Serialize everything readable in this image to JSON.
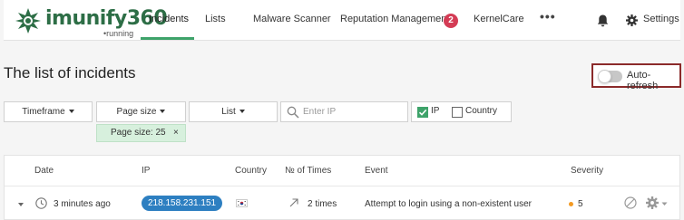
{
  "brand": {
    "name": "imunify360",
    "sub": "•running",
    "color": "#2d6e46"
  },
  "nav": {
    "items": [
      {
        "label": "Incidents",
        "active": true
      },
      {
        "label": "Lists"
      },
      {
        "label": "Malware Scanner"
      },
      {
        "label": "Reputation Management",
        "badge": "2"
      },
      {
        "label": "KernelCare"
      }
    ],
    "more": "•••",
    "settings": "Settings",
    "accent": "#3ea36a"
  },
  "page": {
    "title": "The list of incidents",
    "autorefresh_label": "Auto-refresh",
    "autorefresh_on": false
  },
  "filters": {
    "timeframe": "Timeframe",
    "page_size": "Page size",
    "list": "List",
    "search_placeholder": "Enter IP",
    "ip_label": "IP",
    "ip_checked": true,
    "country_label": "Country",
    "country_checked": false,
    "chip": "Page size: 25",
    "chip_close": "×"
  },
  "table": {
    "headers": [
      "Date",
      "IP",
      "Country",
      "№ of Times",
      "Event",
      "Severity"
    ],
    "rows": [
      {
        "date": "3 minutes ago",
        "ip": "218.158.231.151",
        "country_flag": "south-korea-flag",
        "times": "2 times",
        "event": "Attempt to login using a non-existent user",
        "severity": "5",
        "severity_color": "#f39a23",
        "ip_color": "#2d7fc1"
      }
    ]
  }
}
